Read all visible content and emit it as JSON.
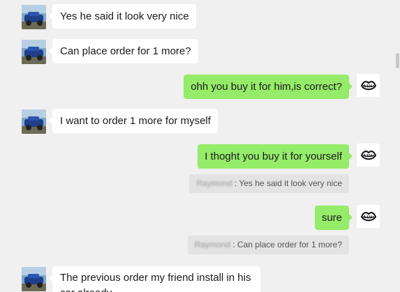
{
  "messages": [
    {
      "side": "in",
      "text": "Yes he said it look very nice"
    },
    {
      "side": "in",
      "text": "Can place order for 1 more?"
    },
    {
      "side": "out",
      "text": "ohh you buy it for him,is correct?"
    },
    {
      "side": "in",
      "text": "I want to order 1 more for myself"
    },
    {
      "side": "out",
      "text": "I thoght you buy it for yourself"
    },
    {
      "side": "quote",
      "sender": "Raymond",
      "text": " : Yes he said it look very nice"
    },
    {
      "side": "out",
      "text": "sure"
    },
    {
      "side": "quote",
      "sender": "Raymond",
      "text": " : Can place order for 1 more?"
    },
    {
      "side": "in",
      "text": "The previous order my friend install in his car already"
    }
  ],
  "avatars": {
    "contact_icon": "blue-car-photo-icon",
    "self_icon": "lips-logo-icon"
  },
  "colors": {
    "background": "#f0f0f0",
    "incoming_bubble": "#ffffff",
    "outgoing_bubble": "#95ec69",
    "quote_bubble": "#e3e3e3"
  }
}
